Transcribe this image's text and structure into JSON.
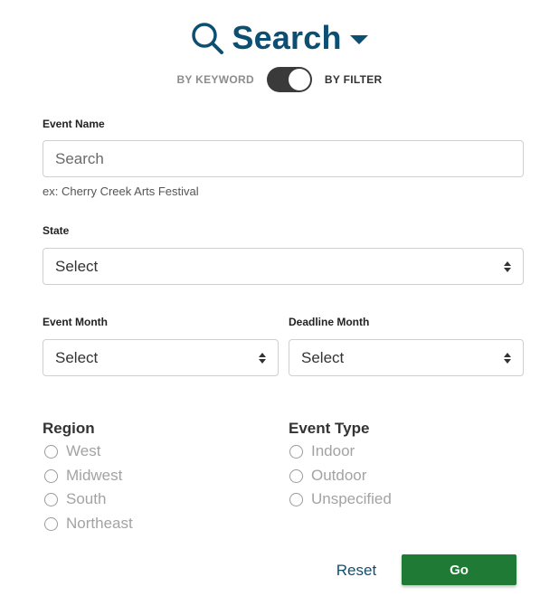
{
  "header": {
    "title": "Search",
    "title_color": "#0d4f73",
    "icon": "search-icon",
    "dropdown_icon": "caret-down-icon"
  },
  "mode_toggle": {
    "left_label": "BY KEYWORD",
    "right_label": "BY FILTER",
    "state": "BY FILTER"
  },
  "event_name": {
    "label": "Event Name",
    "placeholder": "Search",
    "value": "",
    "hint": "ex: Cherry Creek Arts Festival"
  },
  "state": {
    "label": "State",
    "selected": "Select"
  },
  "event_month": {
    "label": "Event Month",
    "selected": "Select"
  },
  "deadline_month": {
    "label": "Deadline Month",
    "selected": "Select"
  },
  "region": {
    "title": "Region",
    "options": [
      "West",
      "Midwest",
      "South",
      "Northeast"
    ]
  },
  "event_type": {
    "title": "Event Type",
    "options": [
      "Indoor",
      "Outdoor",
      "Unspecified"
    ]
  },
  "actions": {
    "reset_label": "Reset",
    "go_label": "Go",
    "go_color": "#1e7a34"
  }
}
